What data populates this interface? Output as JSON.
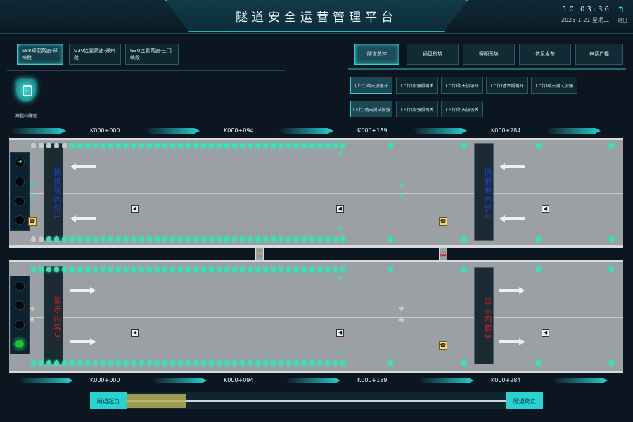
{
  "header": {
    "title": "隧道安全运营管理平台",
    "time": "10:03:36",
    "date": "2025-1-21 星期二",
    "back_label": "退出"
  },
  "sections": [
    {
      "label": "S88郑栾高速-郑州段",
      "active": true
    },
    {
      "label": "G30连霍高速-郑州段",
      "active": false
    },
    {
      "label": "G30连霍高速-三门峡段",
      "active": false
    }
  ],
  "func_tabs": [
    {
      "label": "隧道总控",
      "active": true
    },
    {
      "label": "通风形势",
      "active": false
    },
    {
      "label": "照明形势",
      "active": false
    },
    {
      "label": "信息发布",
      "active": false
    },
    {
      "label": "电话广播",
      "active": false
    }
  ],
  "controls_row1": [
    {
      "label": "(上行)晴天加强开",
      "active": true
    },
    {
      "label": "(上行)加强照明关",
      "active": false
    },
    {
      "label": "(上行)阴天加强开",
      "active": false
    },
    {
      "label": "(上行)基本照明开",
      "active": false
    },
    {
      "label": "(上行)晴天测试加强",
      "active": false
    }
  ],
  "controls_row2": [
    {
      "label": "(下行)晴天测试加强",
      "active": true
    },
    {
      "label": "(下行)加强照明关",
      "active": false
    },
    {
      "label": "(下行)阴天加强关",
      "active": false
    }
  ],
  "tunnel": {
    "name": "嵩祖山隧道",
    "icon": "shield-lock-icon"
  },
  "mileage_top": [
    "K000+000",
    "K000+094",
    "K000+189",
    "K000+284"
  ],
  "mileage_bottom": [
    "K000+000",
    "K000+094",
    "K000+189",
    "K000+284"
  ],
  "upper_vms": [
    {
      "text": "情报板内容1",
      "color": "#1d3fd6"
    },
    {
      "text": "情报板内容2",
      "color": "#1d3fd6"
    }
  ],
  "lower_vms": [
    {
      "text": "显示内容3",
      "color": "#d42020"
    },
    {
      "text": "显示内容3",
      "color": "#d42020"
    }
  ],
  "scrollbar": {
    "start_label": "隧道起点",
    "end_label": "隧道终点",
    "position": 0.06
  },
  "colors": {
    "accent": "#2bd2d2",
    "lamp": "#39e0b8",
    "tube": "#9aa0a4"
  }
}
